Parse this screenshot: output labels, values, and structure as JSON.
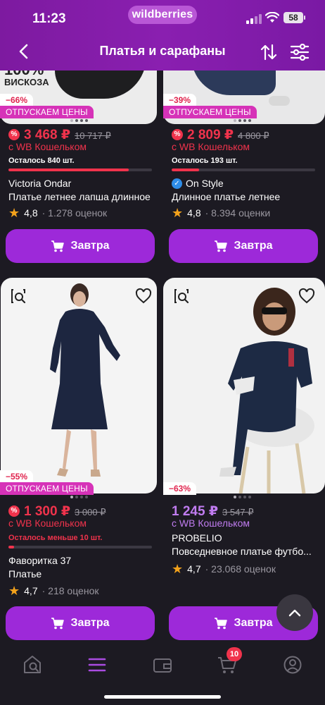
{
  "status_bar": {
    "time": "11:23",
    "brand": "wildberries",
    "battery": "58"
  },
  "nav": {
    "title": "Платья и сарафаны"
  },
  "products": [
    {
      "discount": "−66%",
      "promo": "ОТПУСКАЕМ ЦЕНЫ",
      "price": "3 468 ₽",
      "old_price": "10 717 ₽",
      "wallet": "с WB Кошельком",
      "stock": "Осталось 840 шт.",
      "stock_level": 0.84,
      "brand": "Victoria Ondar",
      "name": "Платье летнее лапша длинное",
      "rating": "4,8",
      "reviews": "· 1.278 оценок",
      "button": "Завтра",
      "img_text_top": "100%",
      "img_text_bottom": "ВИСКОЗА"
    },
    {
      "discount": "−39%",
      "promo": "ОТПУСКАЕМ ЦЕНЫ",
      "price": "2 809 ₽",
      "old_price": "4 800 ₽",
      "wallet": "с WB Кошельком",
      "stock": "Осталось 193 шт.",
      "stock_level": 0.19,
      "brand": "On Style",
      "name": "Длинное платье летнее",
      "rating": "4,8",
      "reviews": "· 8.394 оценки",
      "button": "Завтра"
    },
    {
      "discount": "−55%",
      "promo": "ОТПУСКАЕМ ЦЕНЫ",
      "price": "1 300 ₽",
      "old_price": "3 000 ₽",
      "wallet": "с WB Кошельком",
      "stock": "Осталось меньше 10 шт.",
      "stock_level": 0.04,
      "brand": "Фаворитка 37",
      "name": "Платье",
      "rating": "4,7",
      "reviews": "· 218 оценок",
      "button": "Завтра"
    },
    {
      "discount": "−63%",
      "price": "1 245 ₽",
      "old_price": "3 547 ₽",
      "wallet": "с WB Кошельком",
      "brand": "PROBELIO",
      "name": "Повседневное платье футбо...",
      "rating": "4,7",
      "reviews": "· 23.068 оценок",
      "button": "Завтра"
    }
  ],
  "tab_bar": {
    "cart_badge": "10"
  },
  "colors": {
    "accent": "#9d29d9",
    "sale": "#f0334c",
    "wallet_violet": "#c07cf0",
    "promo": "#d632b8",
    "star": "#f3a21b"
  },
  "icons": [
    "back-icon",
    "sort-icon",
    "filter-icon",
    "heart-icon",
    "similar-search-icon",
    "cart-icon",
    "scroll-top-icon",
    "home-search-icon",
    "catalog-icon",
    "wallet-icon",
    "profile-icon"
  ]
}
